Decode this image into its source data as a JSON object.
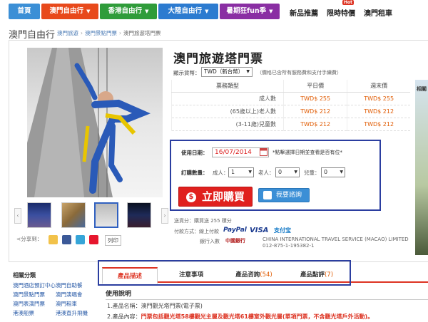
{
  "nav": {
    "items": [
      {
        "label": "首頁",
        "color": "#3b8fd6"
      },
      {
        "label": "澳門自由行",
        "color": "#e8491b"
      },
      {
        "label": "香港自由行",
        "color": "#2f9c3a"
      },
      {
        "label": "大陸自由行",
        "color": "#2c7bd0"
      },
      {
        "label": "暑期狂fun季",
        "color": "#8a2ea3"
      }
    ],
    "plain": [
      "新品推薦",
      "限時特價",
      "澳門租車"
    ],
    "hot_badge": "Hot"
  },
  "page_title": "澳門自由行",
  "breadcrumb": [
    "澳門旅遊",
    "澳門景點門票",
    "澳門旅遊塔門票"
  ],
  "product": {
    "title": "澳門旅遊塔門票",
    "currency_label": "顯示貨幣：",
    "currency_value": "TWD（新台幣）",
    "currency_note": "（價格已含所有服務費和支付手續費）",
    "table_headers": [
      "票務類型",
      "平日價",
      "週末價"
    ],
    "rows": [
      {
        "type": "成人數",
        "weekday": "TWD$ 255",
        "weekend": "TWD$ 255"
      },
      {
        "type": "(65歲以上)老人數",
        "weekday": "TWD$ 212",
        "weekend": "TWD$ 212"
      },
      {
        "type": "(3-11歲)兒童數",
        "weekday": "TWD$ 212",
        "weekend": "TWD$ 212"
      }
    ]
  },
  "booking": {
    "date_label": "使用日期：",
    "date_value": "16/07/2014",
    "date_note": "*點擊選擇日期並查看是否有位*",
    "qty_label": "訂購數量：",
    "adult_label": "成人：",
    "adult_value": "1",
    "senior_label": "老人：",
    "senior_value": "0",
    "child_label": "兒童：",
    "child_value": "0",
    "buy_label": "立即購買",
    "buy_icon": "$",
    "ask_label": "我要諮詢"
  },
  "info": {
    "shipping": "送貨分：購買送 255 積分",
    "payment": "付款方式：線上付款",
    "bank": "銀行入數",
    "bank_name": "CHINA INTERNATIONAL TRAVEL SERVICE (MACAO) LIMITED   012-875-1-195382-1",
    "paypal": "PayPal",
    "visa": "VISA",
    "alipay": "支付宝",
    "bank_logo_text": "中國銀行"
  },
  "share": {
    "label": "分享到：",
    "print": "列印"
  },
  "right_label": "相關",
  "categories": {
    "title": "相關分類",
    "links": [
      "澳門酒店預訂中心",
      "澳門自助餐",
      "澳門景點門票",
      "澳門演唱會",
      "澳門表演門票",
      "澳門租車",
      "港澳船票",
      "港澳直升飛機"
    ]
  },
  "tabs": [
    {
      "label": "產品描述",
      "count": ""
    },
    {
      "label": "注意事項",
      "count": ""
    },
    {
      "label": "產品咨詢",
      "count": "(54)"
    },
    {
      "label": "產品點評",
      "count": "(7)"
    }
  ],
  "usage": {
    "title": "使用說明",
    "line1": "1.產品名稱：澳門觀光塔門票(電子票)",
    "line2_prefix": "2.產品內容：",
    "line2_red": "門票包括觀光塔58樓觀光主層及觀光塔61樓室外觀光層(單項門票，不含觀光塔戶外活動)。"
  }
}
